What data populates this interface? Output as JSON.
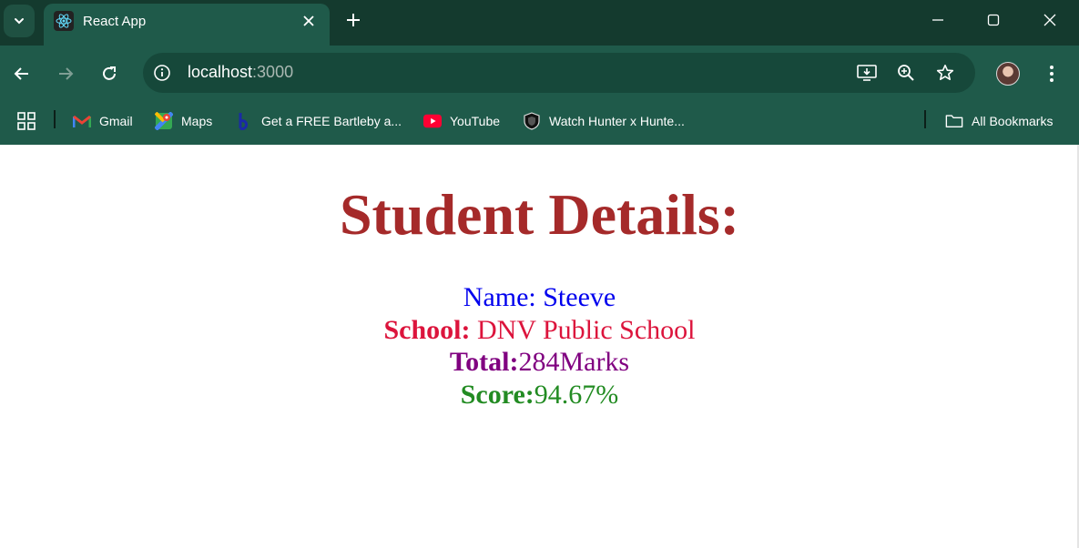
{
  "browser": {
    "tab_title": "React App",
    "url_host": "localhost",
    "url_port": ":3000",
    "theme_colors": {
      "frame": "#143a2e",
      "toolbar": "#1f5a4a",
      "omnibox": "#16483a"
    }
  },
  "bookmarks": [
    {
      "label": "Gmail",
      "icon": "gmail-icon"
    },
    {
      "label": "Maps",
      "icon": "maps-icon"
    },
    {
      "label": "Get a FREE Bartleby a...",
      "icon": "bartleby-icon"
    },
    {
      "label": "YouTube",
      "icon": "youtube-icon"
    },
    {
      "label": "Watch Hunter x Hunte...",
      "icon": "shield-icon"
    }
  ],
  "all_bookmarks_label": "All Bookmarks",
  "page": {
    "heading": "Student Details:",
    "name_label": "Name: ",
    "name_value": "Steeve",
    "school_label": "School:",
    "school_value": " DNV Public School",
    "total_label": "Total:",
    "total_value": "284Marks",
    "score_label": "Score:",
    "score_value": "94.67%",
    "colors": {
      "heading": "#a52a2a",
      "name": "#0000ee",
      "school": "#dc143c",
      "total": "#800080",
      "score": "#228b22"
    }
  }
}
